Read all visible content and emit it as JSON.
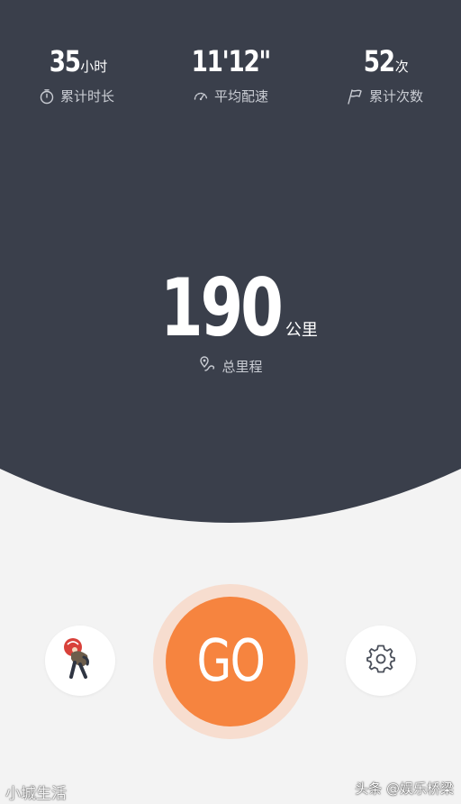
{
  "colors": {
    "panel": "#3a3f4b",
    "background": "#f3f3f3",
    "go_button": "#f6843f",
    "go_ring": "#f7ddcf",
    "label": "#c9ccd3"
  },
  "stats": {
    "duration": {
      "value": "35",
      "unit": "小时",
      "label": "累计时长",
      "icon": "stopwatch-icon"
    },
    "pace": {
      "value": "11'12\"",
      "unit": "",
      "label": "平均配速",
      "icon": "speedometer-icon"
    },
    "count": {
      "value": "52",
      "unit": "次",
      "label": "累计次数",
      "icon": "flag-icon"
    }
  },
  "distance": {
    "value": "190",
    "unit": "公里",
    "label": "总里程",
    "icon": "route-pin-icon"
  },
  "controls": {
    "go_label": "GO",
    "left_button_icon": "runner-avatar-icon",
    "right_button_icon": "gear-icon"
  },
  "watermarks": {
    "left": "小城生活",
    "right": "头条 @娱乐桥梁"
  }
}
